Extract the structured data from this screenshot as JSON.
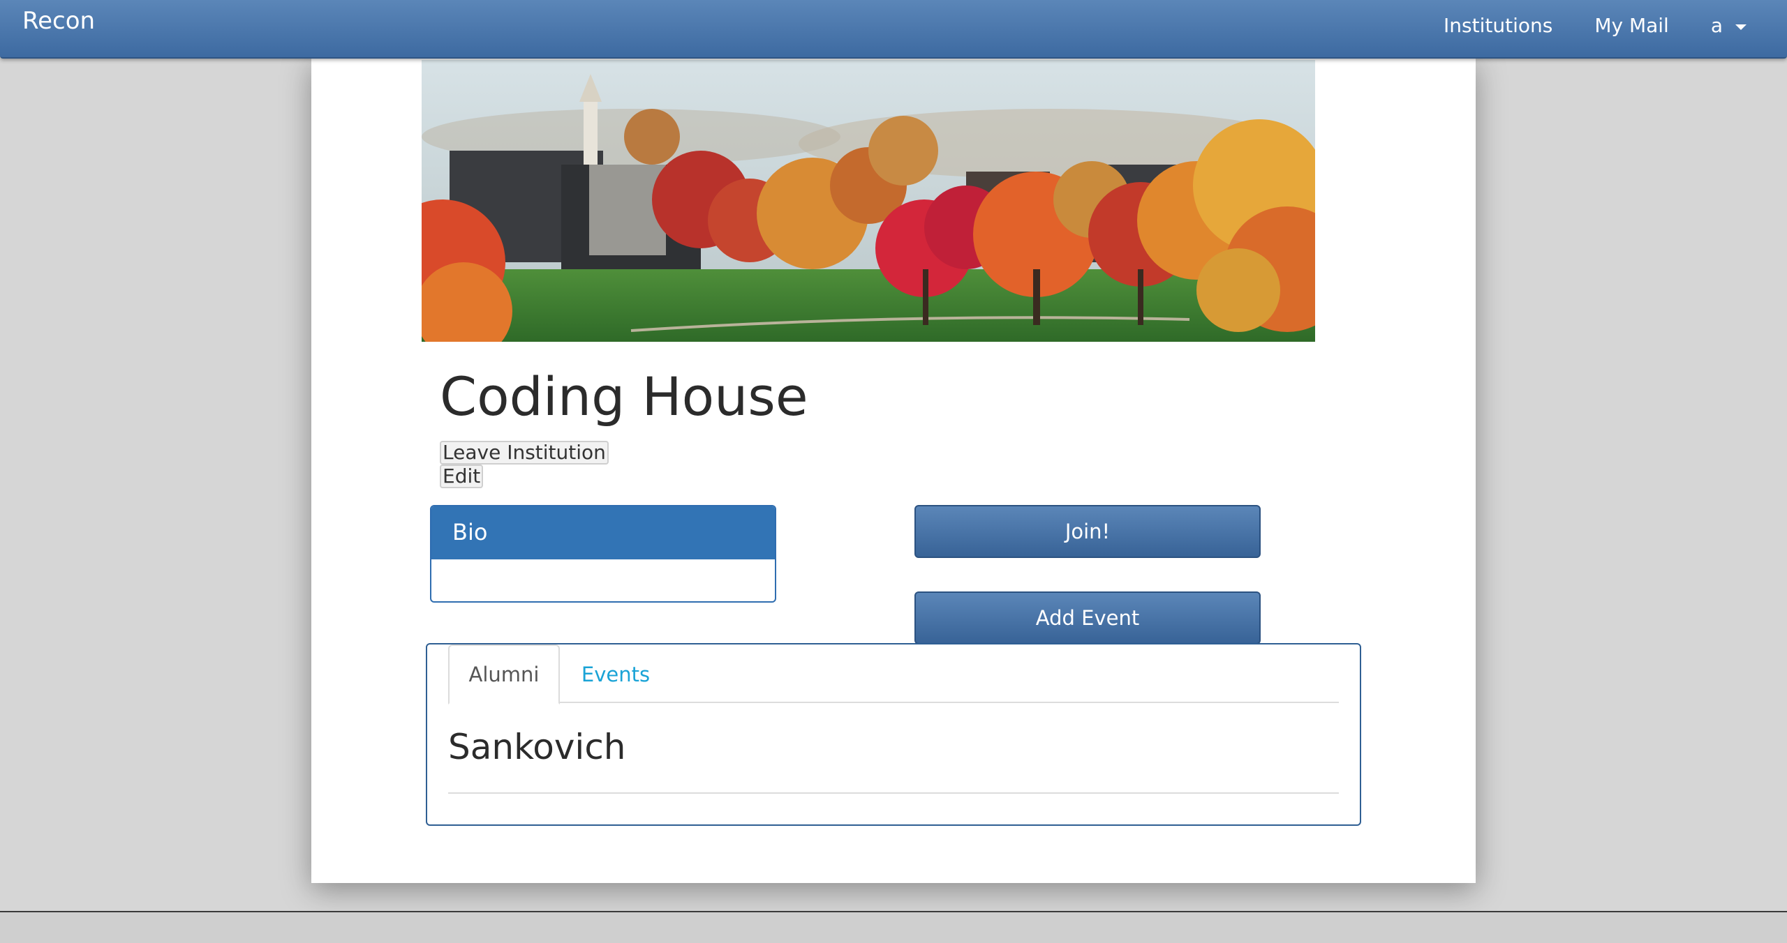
{
  "navbar": {
    "brand": "Recon",
    "links": {
      "institutions": "Institutions",
      "my_mail": "My Mail",
      "user": "a"
    }
  },
  "institution": {
    "name": "Coding House",
    "leave_label": "Leave Institution",
    "edit_label": "Edit"
  },
  "bio": {
    "header": "Bio",
    "content": ""
  },
  "actions": {
    "join_label": "Join!",
    "add_event_label": "Add Event"
  },
  "tabs": {
    "alumni_label": "Alumni",
    "events_label": "Events",
    "alumni": [
      "Sankovich"
    ]
  },
  "colors": {
    "navbar": "#4a78ae",
    "bio_header": "#3274b5",
    "tab_link": "#1aa3d6"
  }
}
